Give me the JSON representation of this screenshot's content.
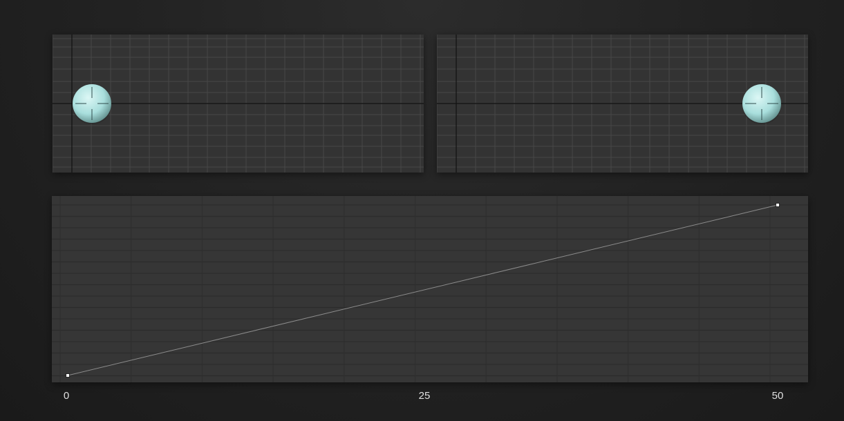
{
  "colors": {
    "panel_background": "#333333",
    "graph_background": "#363636",
    "grid": "#474747",
    "axis": "#111111",
    "sphere": "#a8dedc",
    "curve": "#8c8c8c",
    "keyframe": "#ffffff",
    "tick_label": "#e0e0e0"
  },
  "viewports": [
    {
      "name": "start-frame-viewport",
      "object": "sphere",
      "object_position": "left"
    },
    {
      "name": "end-frame-viewport",
      "object": "sphere",
      "object_position": "right"
    }
  ],
  "timeline": {
    "ticks": [
      "0",
      "25",
      "50"
    ],
    "curve": "linear",
    "keyframes": [
      {
        "frame": 0,
        "value": 0
      },
      {
        "frame": 50,
        "value": 1
      }
    ]
  }
}
